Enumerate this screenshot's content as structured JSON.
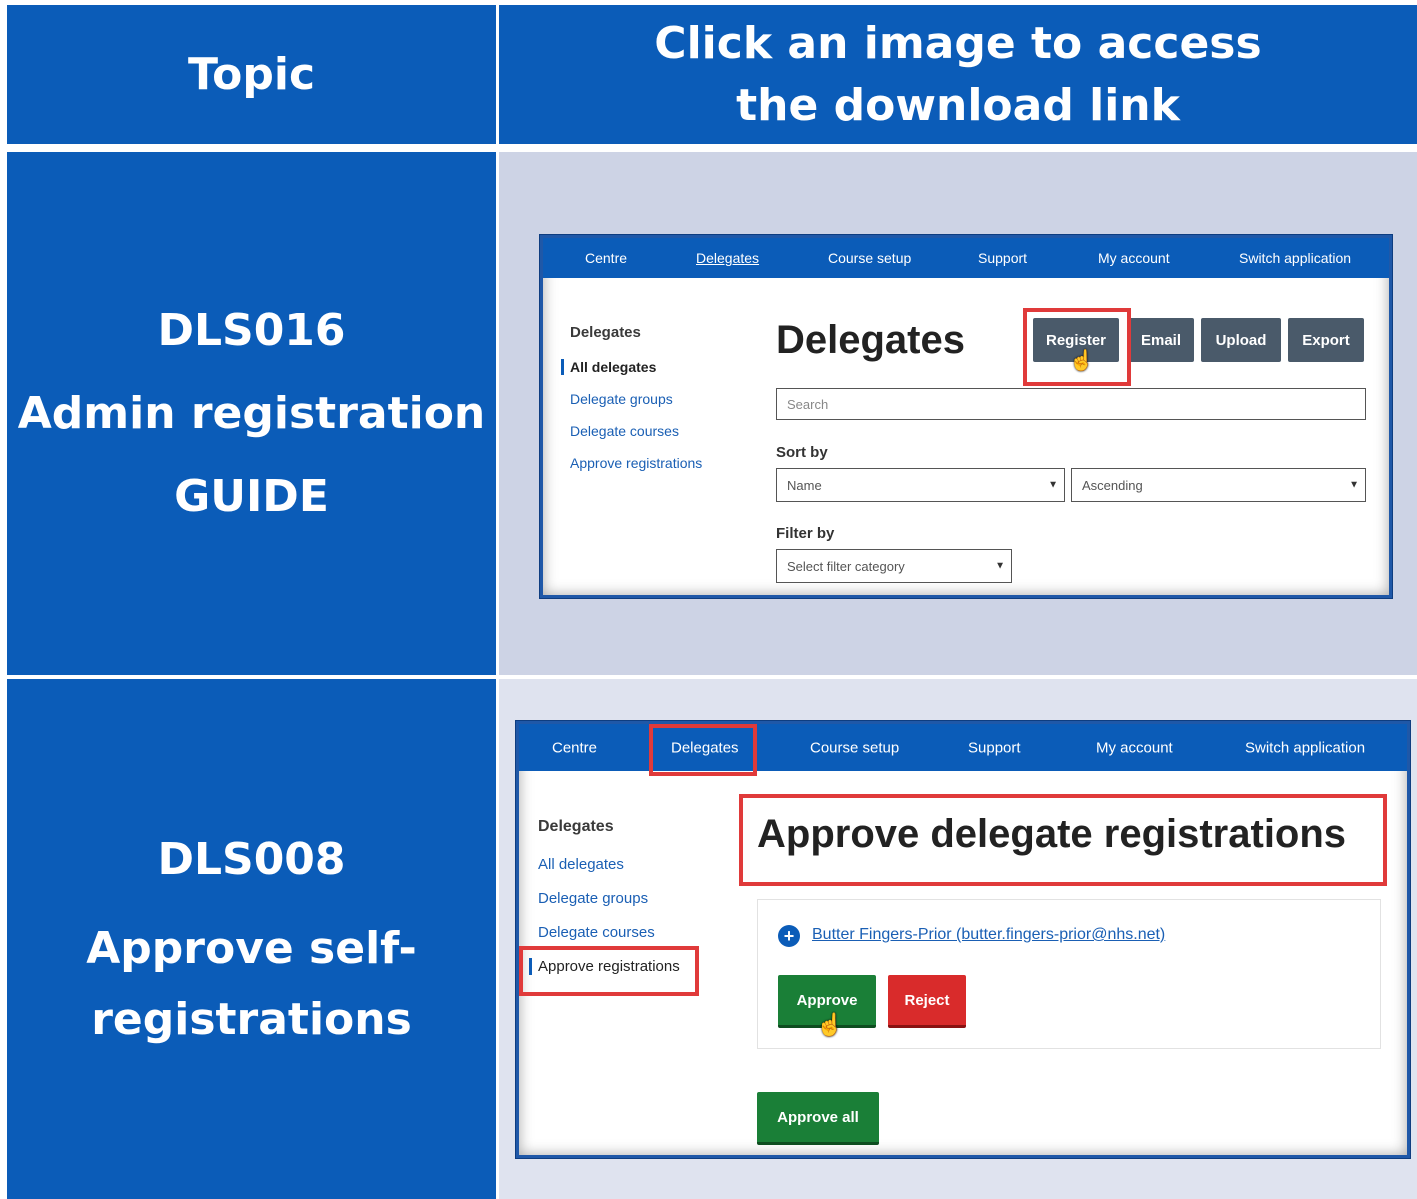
{
  "header": {
    "topic_label": "Topic",
    "instruction_line1": "Click an image to access",
    "instruction_line2": "the download link"
  },
  "rows": [
    {
      "code": "DLS016",
      "title_line1": "Admin registration",
      "title_line2": "GUIDE",
      "screenshot": {
        "nav": [
          "Centre",
          "Delegates",
          "Course setup",
          "Support",
          "My account",
          "Switch application"
        ],
        "side_heading": "Delegates",
        "side_items": [
          "All delegates",
          "Delegate groups",
          "Delegate courses",
          "Approve registrations"
        ],
        "page_title": "Delegates",
        "buttons": [
          "Register",
          "Email",
          "Upload",
          "Export"
        ],
        "search_placeholder": "Search",
        "sort_label": "Sort by",
        "sort_field": "Name",
        "sort_order": "Ascending",
        "filter_label": "Filter by",
        "filter_select": "Select filter category"
      }
    },
    {
      "code": "DLS008",
      "title_line1": "Approve self-",
      "title_line2": "registrations",
      "screenshot": {
        "nav": [
          "Centre",
          "Delegates",
          "Course setup",
          "Support",
          "My account",
          "Switch application"
        ],
        "side_heading": "Delegates",
        "side_items": [
          "All delegates",
          "Delegate groups",
          "Delegate courses",
          "Approve registrations"
        ],
        "page_title": "Approve delegate registrations",
        "registrant": "Butter Fingers-Prior (butter.fingers-prior@nhs.net)",
        "approve_label": "Approve",
        "reject_label": "Reject",
        "approve_all_label": "Approve all"
      }
    }
  ],
  "colors": {
    "brand_blue": "#0b5cb8",
    "highlight_red": "#e03a3a",
    "approve_green": "#1a7f37",
    "reject_red": "#d92b2b"
  }
}
